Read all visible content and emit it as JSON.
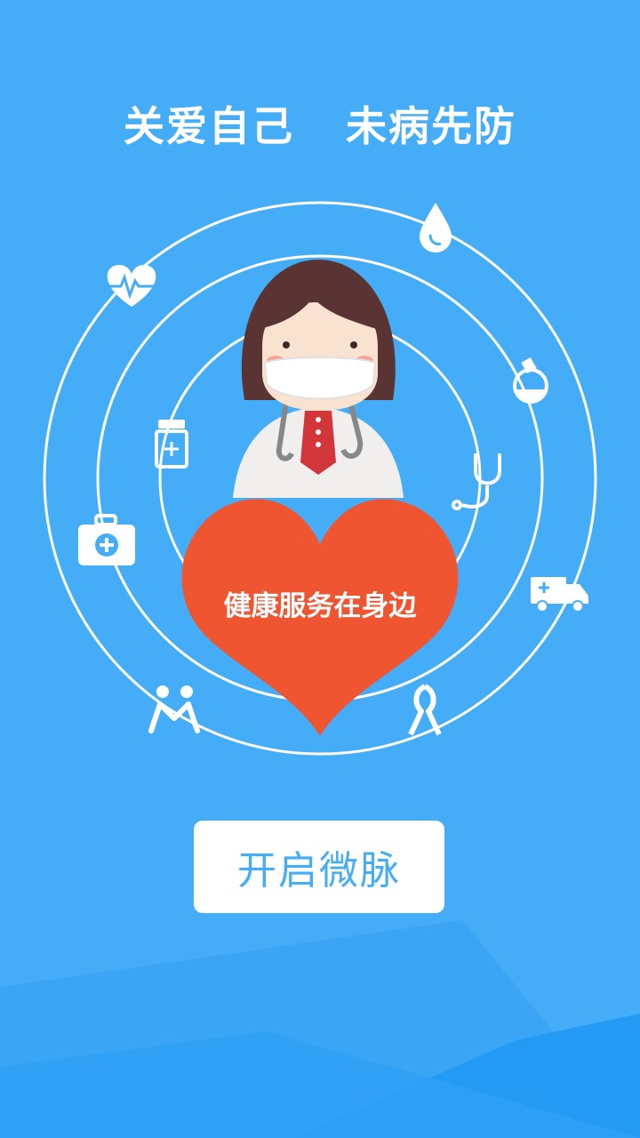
{
  "headline": {
    "left": "关爱自己",
    "right": "未病先防"
  },
  "heart": {
    "caption": "健康服务在身边"
  },
  "cta": {
    "label": "开启微脉"
  },
  "colors": {
    "background": "#45adf8",
    "heart": "#ee5530",
    "button_text": "#45adf8"
  },
  "icons": [
    "heartbeat-icon",
    "water-drop-icon",
    "flask-icon",
    "medicine-bottle-icon",
    "stethoscope-icon",
    "first-aid-kit-icon",
    "ambulance-icon",
    "people-icon",
    "awareness-ribbon-icon",
    "doctor-illustration"
  ]
}
